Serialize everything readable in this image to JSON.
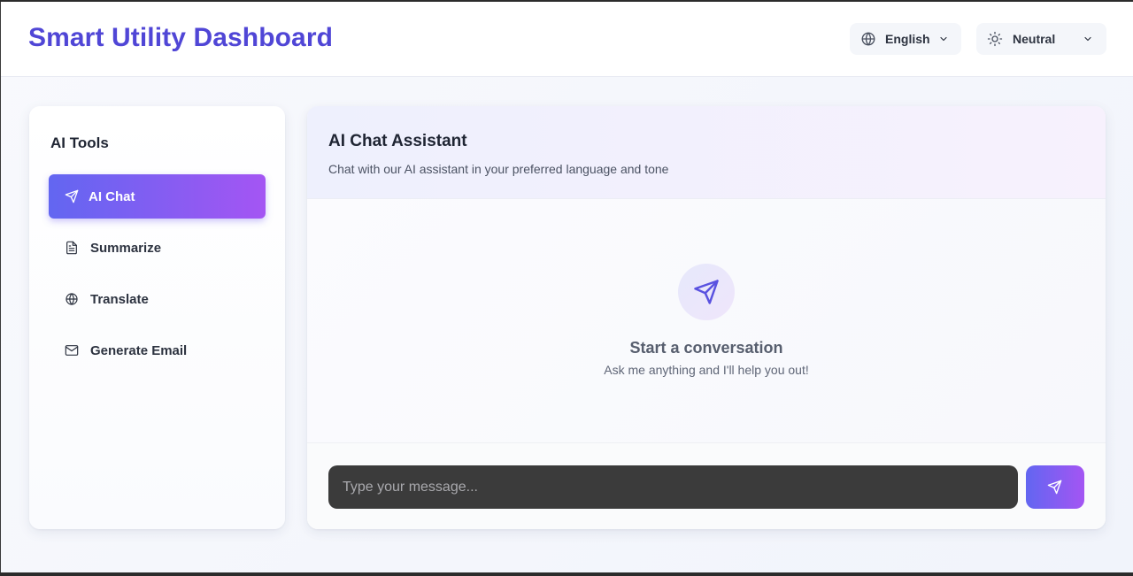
{
  "header": {
    "title": "Smart Utility Dashboard",
    "language_selector": {
      "value": "English",
      "icon": "globe-icon"
    },
    "tone_selector": {
      "value": "Neutral",
      "icon": "sun-icon"
    }
  },
  "sidebar": {
    "title": "AI Tools",
    "items": [
      {
        "label": "AI Chat",
        "icon": "send-icon",
        "active": true
      },
      {
        "label": "Summarize",
        "icon": "document-icon",
        "active": false
      },
      {
        "label": "Translate",
        "icon": "globe-icon",
        "active": false
      },
      {
        "label": "Generate Email",
        "icon": "mail-icon",
        "active": false
      }
    ]
  },
  "main": {
    "title": "AI Chat Assistant",
    "subtitle": "Chat with our AI assistant in your preferred language and tone",
    "empty_state": {
      "icon": "send-icon",
      "title": "Start a conversation",
      "subtitle": "Ask me anything and I'll help you out!"
    },
    "composer": {
      "placeholder": "Type your message...",
      "value": "",
      "send_icon": "send-icon"
    }
  },
  "colors": {
    "brand": "#5046d6",
    "accent_gradient_start": "#6266f1",
    "accent_gradient_end": "#a455f3",
    "input_background": "#3b3b3b"
  }
}
